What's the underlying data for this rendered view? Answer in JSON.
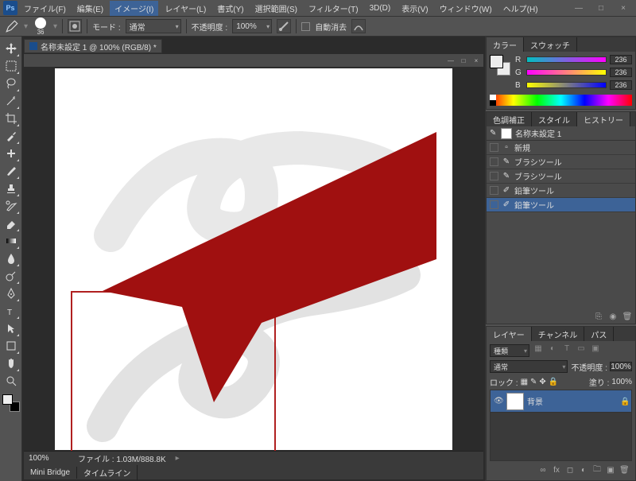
{
  "menu": {
    "items": [
      "ファイル(F)",
      "編集(E)",
      "イメージ(I)",
      "レイヤー(L)",
      "書式(Y)",
      "選択範囲(S)",
      "フィルター(T)",
      "3D(D)",
      "表示(V)",
      "ウィンドウ(W)",
      "ヘルプ(H)"
    ],
    "selected": 2,
    "logo": "Ps"
  },
  "options": {
    "brush_size": "36",
    "mode_label": "モード :",
    "mode_value": "通常",
    "opacity_label": "不透明度 :",
    "opacity_value": "100%",
    "autoerase_label": "自動消去"
  },
  "doc": {
    "tab": "名称未設定 1 @ 100% (RGB/8) *",
    "zoom": "100%",
    "file_label": "ファイル :",
    "file_value": "1.03M/888.8K"
  },
  "colorPanel": {
    "tabs": [
      "カラー",
      "スウォッチ"
    ],
    "channels": [
      {
        "ch": "R",
        "val": "236"
      },
      {
        "ch": "G",
        "val": "236"
      },
      {
        "ch": "B",
        "val": "236"
      }
    ]
  },
  "adjustPanel": {
    "tabs": [
      "色調補正",
      "スタイル",
      "ヒストリー"
    ],
    "doc": "名称未設定 1",
    "items": [
      {
        "label": "新規",
        "icon": "doc"
      },
      {
        "label": "ブラシツール",
        "icon": "brush"
      },
      {
        "label": "ブラシツール",
        "icon": "brush"
      },
      {
        "label": "鉛筆ツール",
        "icon": "pencil"
      },
      {
        "label": "鉛筆ツール",
        "icon": "pencil"
      }
    ],
    "selectedItem": 4
  },
  "layerPanel": {
    "tabs": [
      "レイヤー",
      "チャンネル",
      "パス"
    ],
    "kind": "種類",
    "blend": "通常",
    "opacity_label": "不透明度 :",
    "opacity_value": "100%",
    "lock_label": "ロック :",
    "fill_label": "塗り :",
    "fill_value": "100%",
    "layers": [
      {
        "name": "背景",
        "locked": true
      }
    ]
  },
  "bottom": {
    "tabs": [
      "Mini Bridge",
      "タイムライン"
    ]
  }
}
